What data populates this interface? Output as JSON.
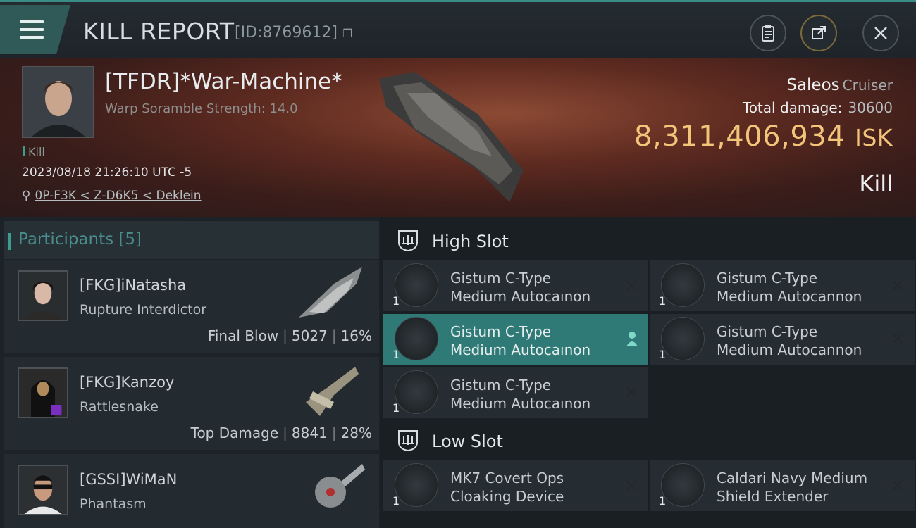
{
  "header": {
    "title": "KILL REPORT",
    "id": "[ID:8769612]",
    "icons": [
      "menu-icon",
      "clipboard-icon",
      "share-icon",
      "close-icon"
    ]
  },
  "victim": {
    "name": "[TFDR]*War-Machine*",
    "subtitle": "Warp Soramble Strength: 14.0",
    "tag": "Kill",
    "datetime": "2023/08/18 21:26:10 UTC -5",
    "location": "0P-F3K < Z-D6K5 < Deklein",
    "ship": "Saleos",
    "ship_class": "Cruiser",
    "total_damage_label": "Total damage:",
    "total_damage": "30600",
    "isk_value": "8,311,406,934",
    "isk_unit": "ISK",
    "result": "Kill"
  },
  "participants": {
    "label": "Participants [5]",
    "items": [
      {
        "name": "[FKG]iNatasha",
        "ship": "Rupture Interdictor",
        "role": "Final Blow",
        "damage": "5027",
        "percent": "16%"
      },
      {
        "name": "[FKG]Kanzoy",
        "ship": "Rattlesnake",
        "role": "Top Damage",
        "damage": "8841",
        "percent": "28%"
      },
      {
        "name": "[GSSI]WiMaN",
        "ship": "Phantasm",
        "role": "",
        "damage": "",
        "percent": ""
      }
    ]
  },
  "slots": {
    "high": {
      "label": "High Slot",
      "modules": [
        {
          "line1": "Gistum C-Type",
          "line2": "Medium Autocaınon",
          "qty": "1"
        },
        {
          "line1": "Gistum C-Type",
          "line2": "Medium Autocannon",
          "qty": "1"
        },
        {
          "line1": "Gistum C-Type",
          "line2": "Medium Autocaınon",
          "qty": "1"
        },
        {
          "line1": "Gistum C-Type",
          "line2": "Medium Autocannon",
          "qty": "1"
        },
        {
          "line1": "Gistum C-Type",
          "line2": "Medium Autocaınon",
          "qty": "1"
        }
      ]
    },
    "low": {
      "label": "Low Slot",
      "modules": [
        {
          "line1": "MK7 Covert Ops",
          "line2": "Cloaking Device",
          "qty": "1"
        },
        {
          "line1": "Caldari Navy Medium",
          "line2": "Shield Extender",
          "qty": "1"
        }
      ]
    }
  },
  "colors": {
    "accent": "#3d9d90",
    "isk": "#f3c57a",
    "active_row": "#2f7a77"
  }
}
